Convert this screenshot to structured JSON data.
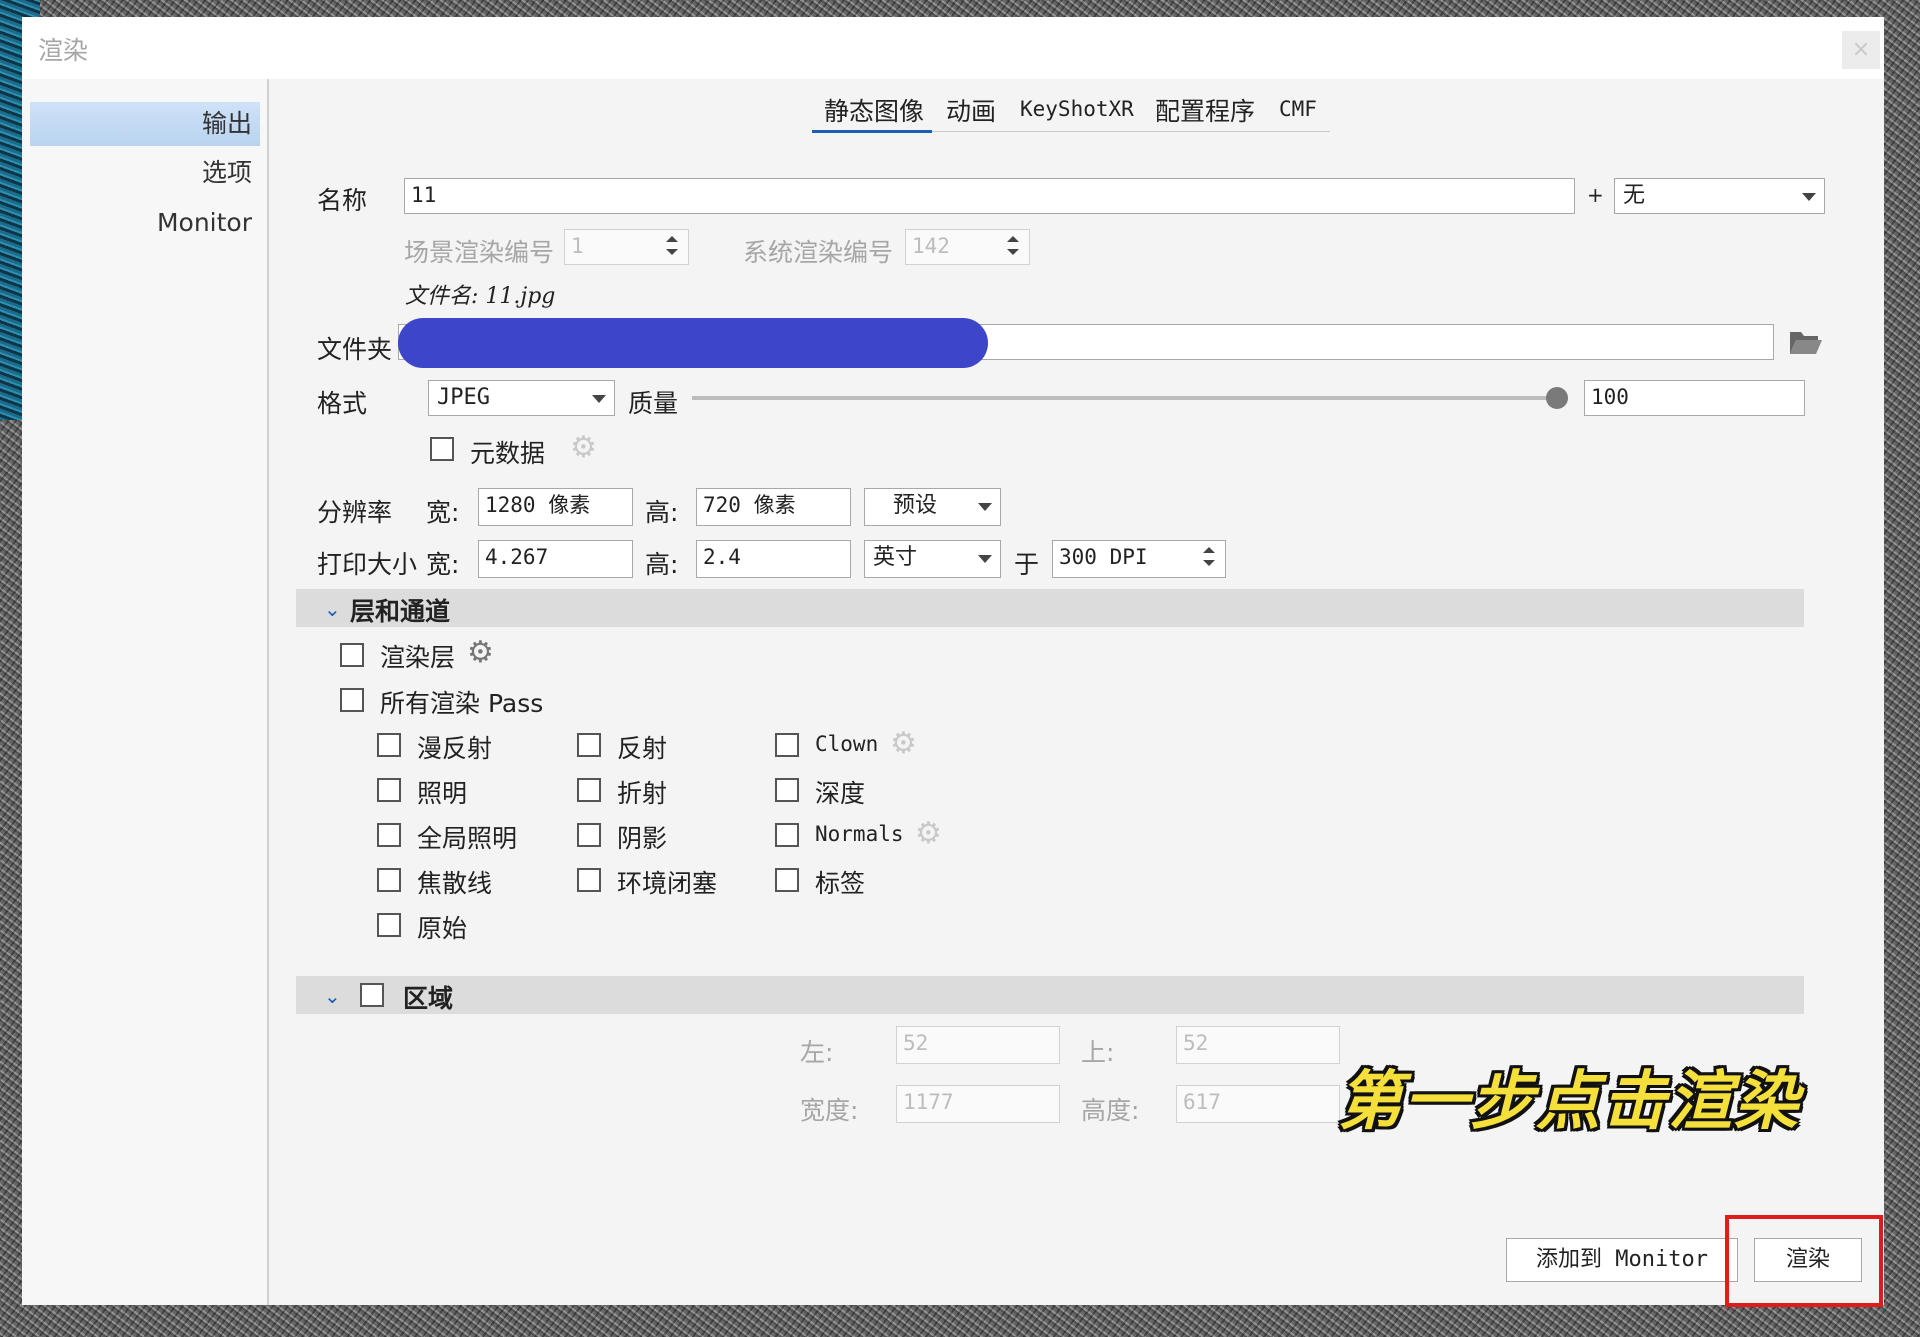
{
  "window": {
    "title": "渲染",
    "close_label": "×"
  },
  "sidebar": {
    "items": [
      {
        "label": "输出"
      },
      {
        "label": "选项"
      },
      {
        "label": "Monitor"
      }
    ]
  },
  "tabs": [
    {
      "label": "静态图像"
    },
    {
      "label": "动画"
    },
    {
      "label": "KeyShotXR"
    },
    {
      "label": "配置程序"
    },
    {
      "label": "CMF"
    }
  ],
  "name_row": {
    "label": "名称",
    "value": "11",
    "plus": "+",
    "suffix_select": "无"
  },
  "render_numbers": {
    "scene_label": "场景渲染编号",
    "scene_value": "1",
    "system_label": "系统渲染编号",
    "system_value": "142"
  },
  "filename": "文件名: 11.jpg",
  "folder": {
    "label": "文件夹",
    "value": ""
  },
  "format": {
    "label": "格式",
    "value": "JPEG",
    "quality_label": "质量",
    "quality_value": "100",
    "quality_fraction": 1.0
  },
  "metadata": {
    "label": "元数据"
  },
  "resolution": {
    "label": "分辨率",
    "width_label": "宽:",
    "width_value": "1280 像素",
    "height_label": "高:",
    "height_value": "720 像素",
    "preset": "预设"
  },
  "print_size": {
    "label": "打印大小",
    "width_label": "宽:",
    "width_value": "4.267",
    "height_label": "高:",
    "height_value": "2.4",
    "unit": "英寸",
    "at_label": "于",
    "dpi": "300 DPI"
  },
  "layers": {
    "title": "层和通道",
    "render_layers": "渲染层",
    "all_passes": "所有渲染 Pass",
    "col1": [
      "漫反射",
      "照明",
      "全局照明",
      "焦散线",
      "原始"
    ],
    "col2": [
      "反射",
      "折射",
      "阴影",
      "环境闭塞"
    ],
    "col3": [
      "Clown",
      "深度",
      "Normals",
      "标签"
    ]
  },
  "region": {
    "title": "区域",
    "left_label": "左:",
    "left_value": "52",
    "top_label": "上:",
    "top_value": "52",
    "width_label": "宽度:",
    "width_value": "1177",
    "height_label": "高度:",
    "height_value": "617"
  },
  "buttons": {
    "add_monitor": "添加到 Monitor",
    "render": "渲染"
  },
  "overlay": {
    "caption": "第一步点击渲染",
    "highlight_color": "#e01b1b"
  }
}
